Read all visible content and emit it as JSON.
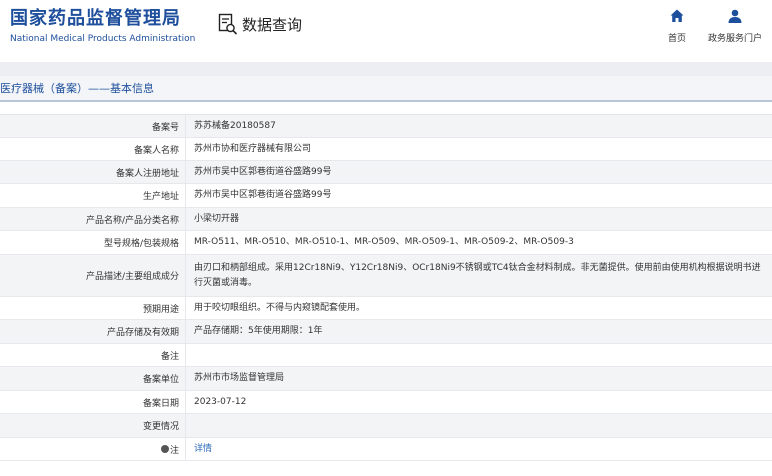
{
  "header": {
    "logo_cn": "国家药品监督管理局",
    "logo_en": "National Medical Products Administration",
    "query_label": "数据查询",
    "nav": [
      {
        "label": "首页",
        "icon": "home-icon"
      },
      {
        "label": "政务服务门户",
        "icon": "user-icon"
      }
    ]
  },
  "section_title": "医疗器械（备案）——基本信息",
  "rows": [
    {
      "label": "备案号",
      "value": "苏苏械备20180587"
    },
    {
      "label": "备案人名称",
      "value": "苏州市协和医疗器械有限公司"
    },
    {
      "label": "备案人注册地址",
      "value": "苏州市吴中区郭巷街道谷盛路99号"
    },
    {
      "label": "生产地址",
      "value": "苏州市吴中区郭巷街道谷盛路99号"
    },
    {
      "label": "产品名称/产品分类名称",
      "value": "小梁切开器"
    },
    {
      "label": "型号规格/包装规格",
      "value": "MR-O511、MR-O510、MR-O510-1、MR-O509、MR-O509-1、MR-O509-2、MR-O509-3"
    },
    {
      "label": "产品描述/主要组成成分",
      "value": "由刃口和柄部组成。采用12Cr18Ni9、Y12Cr18Ni9、OCr18Ni9不锈钢或TC4钛合金材料制成。非无菌提供。使用前由使用机构根据说明书进行灭菌或消毒。"
    },
    {
      "label": "预期用途",
      "value": "用于咬切眼组织。不得与内窥镜配套使用。"
    },
    {
      "label": "产品存储及有效期",
      "value": "产品存储期：5年使用期限：1年"
    },
    {
      "label": "备注",
      "value": ""
    },
    {
      "label": "备案单位",
      "value": "苏州市市场监督管理局"
    },
    {
      "label": "备案日期",
      "value": "2023-07-12"
    },
    {
      "label": "变更情况",
      "value": ""
    },
    {
      "label": "注",
      "value": "详情"
    }
  ],
  "colors": {
    "brand": "#1e4f9c",
    "link": "#2a68b8"
  }
}
